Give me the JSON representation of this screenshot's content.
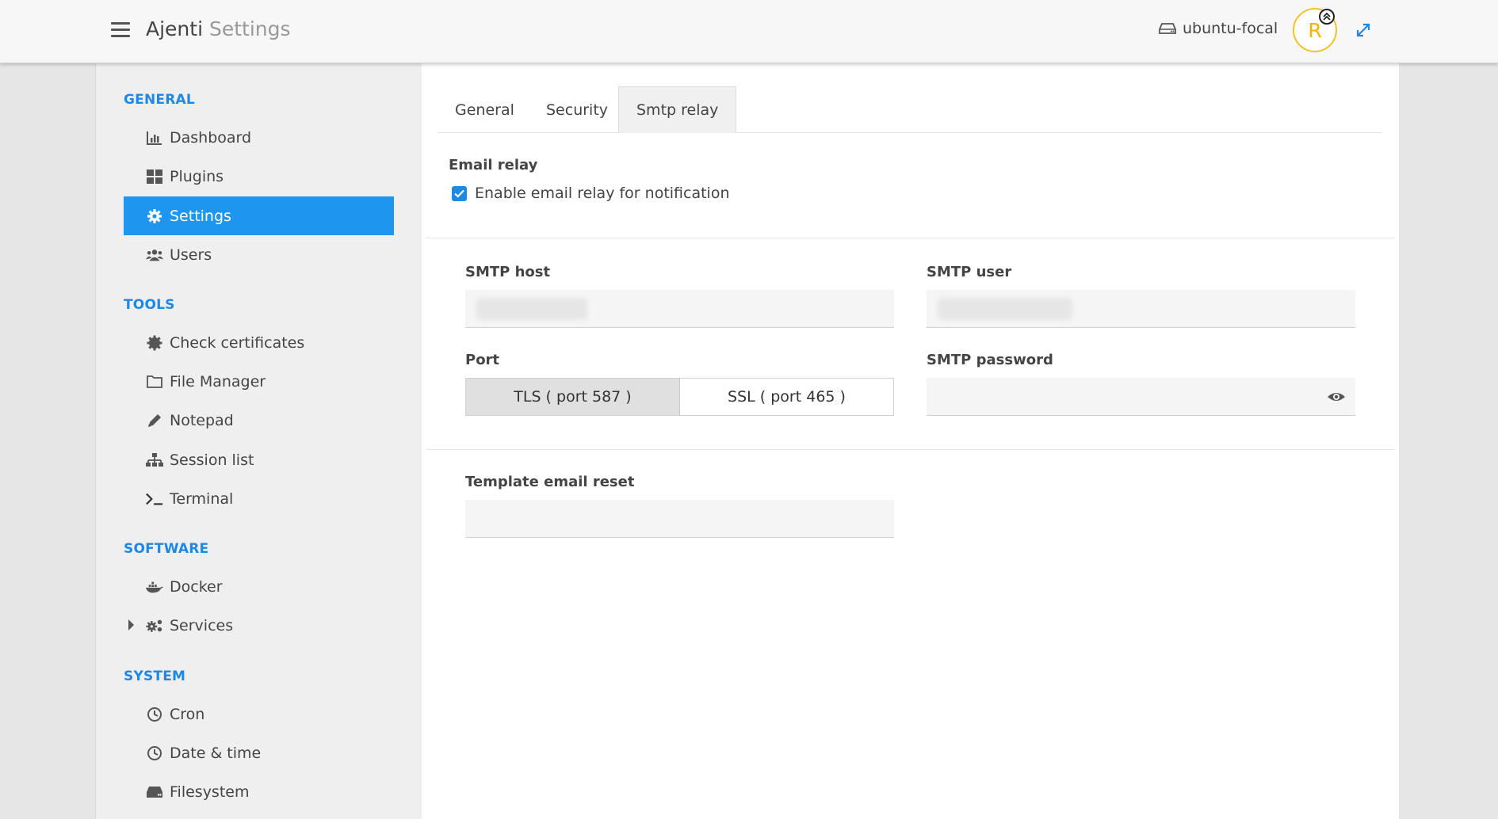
{
  "header": {
    "app_name": "Ajenti",
    "page_name": "Settings",
    "hostname": "ubuntu-focal",
    "avatar_initial": "R"
  },
  "sidebar": {
    "sections": [
      {
        "title": "GENERAL",
        "items": [
          {
            "label": "Dashboard",
            "icon": "bar-chart-icon"
          },
          {
            "label": "Plugins",
            "icon": "grid-icon"
          },
          {
            "label": "Settings",
            "icon": "gear-icon",
            "active": true
          },
          {
            "label": "Users",
            "icon": "users-icon"
          }
        ]
      },
      {
        "title": "TOOLS",
        "items": [
          {
            "label": "Check certificates",
            "icon": "certificate-icon"
          },
          {
            "label": "File Manager",
            "icon": "folder-icon"
          },
          {
            "label": "Notepad",
            "icon": "pencil-icon"
          },
          {
            "label": "Session list",
            "icon": "sitemap-icon"
          },
          {
            "label": "Terminal",
            "icon": "terminal-icon"
          }
        ]
      },
      {
        "title": "SOFTWARE",
        "items": [
          {
            "label": "Docker",
            "icon": "docker-icon"
          },
          {
            "label": "Services",
            "icon": "cogs-icon",
            "expandable": true
          }
        ]
      },
      {
        "title": "SYSTEM",
        "items": [
          {
            "label": "Cron",
            "icon": "clock-icon"
          },
          {
            "label": "Date & time",
            "icon": "clock-icon"
          },
          {
            "label": "Filesystem",
            "icon": "hdd-icon"
          }
        ]
      }
    ]
  },
  "tabs": [
    {
      "label": "General"
    },
    {
      "label": "Security"
    },
    {
      "label": "Smtp relay",
      "active": true
    }
  ],
  "form": {
    "email_relay_label": "Email relay",
    "enable_relay_label": "Enable email relay for notification",
    "enable_relay_checked": true,
    "smtp_host_label": "SMTP host",
    "smtp_user_label": "SMTP user",
    "port_label": "Port",
    "port_options": [
      "TLS ( port 587 )",
      "SSL ( port 465 )"
    ],
    "port_selected": "TLS ( port 587 )",
    "smtp_password_label": "SMTP password",
    "template_label": "Template email reset"
  },
  "colors": {
    "accent": "#1e96f0",
    "section_title": "#1e88e5",
    "avatar_ring": "#f3c228"
  }
}
